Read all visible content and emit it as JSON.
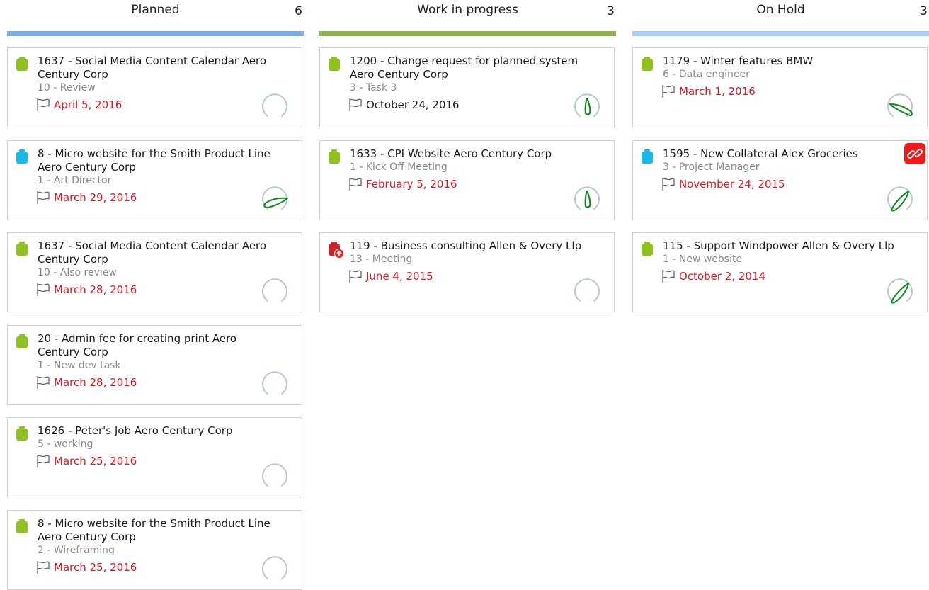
{
  "columns": [
    {
      "title": "Planned",
      "count": "6",
      "bar_color": "#7aaee6",
      "cards": [
        {
          "title": "1637 - Social Media Content Calendar Aero Century Corp",
          "sub": "10 - Review",
          "date": "April 5, 2016",
          "date_color": "#e0141e",
          "icon": "clipboard-icon",
          "icon_color": "#8fc21f",
          "gauge": "empty"
        },
        {
          "title": "8 - Micro website for the Smith Product Line Aero Century Corp",
          "sub": "1 - Art Director",
          "date": "March 29, 2016",
          "date_color": "#e0141e",
          "icon": "clipboard-icon",
          "icon_color": "#19b8e8",
          "gauge": "needle-right"
        },
        {
          "title": "1637 - Social Media Content Calendar Aero Century Corp",
          "sub": "10 - Also review",
          "date": "March 28, 2016",
          "date_color": "#e0141e",
          "icon": "clipboard-icon",
          "icon_color": "#8fc21f",
          "gauge": "empty"
        },
        {
          "title": "20 - Admin fee for creating print Aero Century Corp",
          "sub": "1 - New dev task",
          "date": "March 28, 2016",
          "date_color": "#e0141e",
          "icon": "clipboard-icon",
          "icon_color": "#8fc21f",
          "gauge": "empty"
        },
        {
          "title": "1626 - Peter's Job Aero Century Corp",
          "sub": "5 - working",
          "date": "March 25, 2016",
          "date_color": "#e0141e",
          "icon": "clipboard-icon",
          "icon_color": "#8fc21f",
          "gauge": "empty"
        },
        {
          "title": "8 - Micro website for the Smith Product Line Aero Century Corp",
          "sub": "2 - Wireframing",
          "date": "March 25, 2016",
          "date_color": "#e0141e",
          "icon": "clipboard-icon",
          "icon_color": "#8fc21f",
          "gauge": "empty"
        }
      ]
    },
    {
      "title": "Work in progress",
      "count": "3",
      "bar_color": "#8bb04c",
      "cards": [
        {
          "title": "1200 - Change request for planned system Aero Century Corp",
          "sub": "3 - Task 3",
          "date": "October 24, 2016",
          "date_color": "#1a1a1a",
          "icon": "clipboard-icon",
          "icon_color": "#8fc21f",
          "gauge": "needle-up"
        },
        {
          "title": "1633 - CPI Website Aero Century Corp",
          "sub": "1 - Kick Off Meeting",
          "date": "February 5, 2016",
          "date_color": "#e0141e",
          "icon": "clipboard-icon",
          "icon_color": "#8fc21f",
          "gauge": "needle-up"
        },
        {
          "title": "119 - Business consulting Allen & Overy Llp",
          "sub": "13 - Meeting",
          "date": "June 4, 2015",
          "date_color": "#e0141e",
          "icon": "clipboard-upload-icon",
          "icon_color": "#c8262a",
          "gauge": "empty"
        }
      ]
    },
    {
      "title": "On Hold",
      "count": "3",
      "bar_color": "#a8d0f5",
      "cards": [
        {
          "title": "1179 - Winter features BMW",
          "sub": "6 - Data engineer",
          "date": "March 1, 2016",
          "date_color": "#e0141e",
          "icon": "clipboard-icon",
          "icon_color": "#8fc21f",
          "gauge": "needle-upleft"
        },
        {
          "title": "1595 - New Collateral Alex Groceries",
          "sub": "3 - Project Manager",
          "date": "November 24, 2015",
          "date_color": "#e0141e",
          "icon": "clipboard-icon",
          "icon_color": "#19b8e8",
          "gauge": "needle-upright",
          "badge": "link-icon"
        },
        {
          "title": "115 - Support Windpower Allen & Overy Llp",
          "sub": "1 - New website",
          "date": "October 2, 2014",
          "date_color": "#e0141e",
          "icon": "clipboard-icon",
          "icon_color": "#8fc21f",
          "gauge": "needle-upright"
        }
      ]
    }
  ]
}
